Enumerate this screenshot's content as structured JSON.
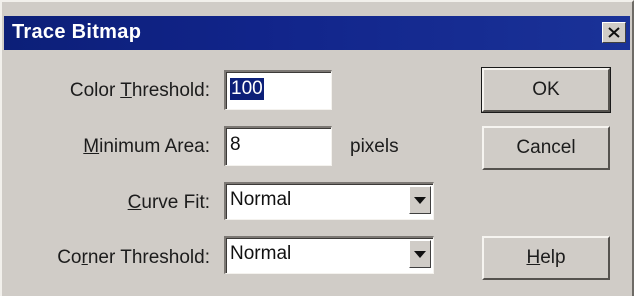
{
  "window": {
    "title": "Trace Bitmap",
    "close_icon": "close-icon"
  },
  "form": {
    "color_threshold": {
      "label_pre": "Color ",
      "label_accel": "T",
      "label_post": "hreshold:",
      "value": "100"
    },
    "minimum_area": {
      "label_pre": "",
      "label_accel": "M",
      "label_post": "inimum Area:",
      "value": "8",
      "suffix": "pixels"
    },
    "curve_fit": {
      "label_pre": "",
      "label_accel": "C",
      "label_post": "urve Fit:",
      "selected": "Normal"
    },
    "corner_threshold": {
      "label_pre": "Co",
      "label_accel": "r",
      "label_post": "ner Threshold:",
      "selected": "Normal"
    }
  },
  "buttons": {
    "ok": "OK",
    "cancel": "Cancel",
    "help_accel": "H",
    "help_post": "elp"
  },
  "colors": {
    "title_bar": "#0c1f78",
    "face": "#d0ccc7",
    "selection": "#0c1f78"
  }
}
